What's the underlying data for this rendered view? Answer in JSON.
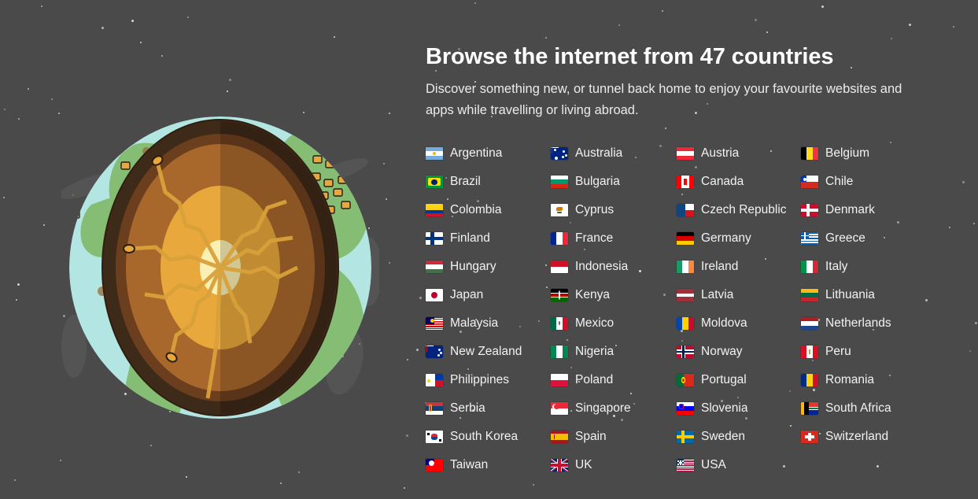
{
  "page": {
    "background_color": "#4a4a4a",
    "text_color": "#f2f2f2"
  },
  "header": {
    "title": "Browse the internet from 47 countries",
    "subtitle": "Discover something new, or tunnel back home to enjoy your favourite websites and apps while travelling or living abroad."
  },
  "illustration": {
    "name": "earth-cutaway-globe",
    "description": "Cutaway cross-section of the Earth showing crust, mantle, outer core and inner core with golden tunnels radiating to country markers",
    "colors": {
      "ocean": "#b3e6e2",
      "land": "#84bd73",
      "land_shadow": "#6fae63",
      "crust": "#3e2a18",
      "mantle_outer": "#6b3f1d",
      "mantle_inner": "#a8682c",
      "outer_core": "#e8a83c",
      "inner_core": "#fbf0b4",
      "tunnel": "#d9a13a",
      "cloud": "#6a6a6a"
    }
  },
  "countries": [
    {
      "name": "Argentina",
      "code": "AR"
    },
    {
      "name": "Australia",
      "code": "AU"
    },
    {
      "name": "Austria",
      "code": "AT"
    },
    {
      "name": "Belgium",
      "code": "BE"
    },
    {
      "name": "Brazil",
      "code": "BR"
    },
    {
      "name": "Bulgaria",
      "code": "BG"
    },
    {
      "name": "Canada",
      "code": "CA"
    },
    {
      "name": "Chile",
      "code": "CL"
    },
    {
      "name": "Colombia",
      "code": "CO"
    },
    {
      "name": "Cyprus",
      "code": "CY"
    },
    {
      "name": "Czech Republic",
      "code": "CZ"
    },
    {
      "name": "Denmark",
      "code": "DK"
    },
    {
      "name": "Finland",
      "code": "FI"
    },
    {
      "name": "France",
      "code": "FR"
    },
    {
      "name": "Germany",
      "code": "DE"
    },
    {
      "name": "Greece",
      "code": "GR"
    },
    {
      "name": "Hungary",
      "code": "HU"
    },
    {
      "name": "Indonesia",
      "code": "ID"
    },
    {
      "name": "Ireland",
      "code": "IE"
    },
    {
      "name": "Italy",
      "code": "IT"
    },
    {
      "name": "Japan",
      "code": "JP"
    },
    {
      "name": "Kenya",
      "code": "KE"
    },
    {
      "name": "Latvia",
      "code": "LV"
    },
    {
      "name": "Lithuania",
      "code": "LT"
    },
    {
      "name": "Malaysia",
      "code": "MY"
    },
    {
      "name": "Mexico",
      "code": "MX"
    },
    {
      "name": "Moldova",
      "code": "MD"
    },
    {
      "name": "Netherlands",
      "code": "NL"
    },
    {
      "name": "New Zealand",
      "code": "NZ"
    },
    {
      "name": "Nigeria",
      "code": "NG"
    },
    {
      "name": "Norway",
      "code": "NO"
    },
    {
      "name": "Peru",
      "code": "PE"
    },
    {
      "name": "Philippines",
      "code": "PH"
    },
    {
      "name": "Poland",
      "code": "PL"
    },
    {
      "name": "Portugal",
      "code": "PT"
    },
    {
      "name": "Romania",
      "code": "RO"
    },
    {
      "name": "Serbia",
      "code": "RS"
    },
    {
      "name": "Singapore",
      "code": "SG"
    },
    {
      "name": "Slovenia",
      "code": "SI"
    },
    {
      "name": "South Africa",
      "code": "ZA"
    },
    {
      "name": "South Korea",
      "code": "KR"
    },
    {
      "name": "Spain",
      "code": "ES"
    },
    {
      "name": "Sweden",
      "code": "SE"
    },
    {
      "name": "Switzerland",
      "code": "CH"
    },
    {
      "name": "Taiwan",
      "code": "TW"
    },
    {
      "name": "UK",
      "code": "GB"
    },
    {
      "name": "USA",
      "code": "US"
    }
  ]
}
